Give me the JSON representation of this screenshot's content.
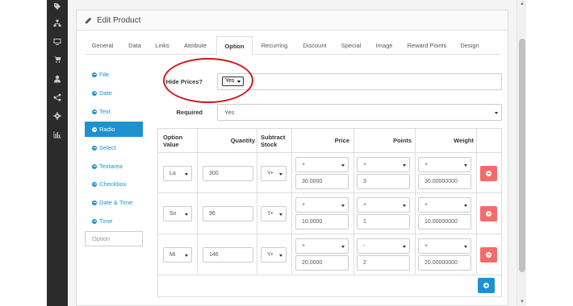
{
  "sidebar": {
    "icons": [
      "tags-icon",
      "sitemap-icon",
      "desktop-icon",
      "cart-icon",
      "user-icon",
      "share-icon",
      "cog-icon",
      "bar-chart-icon"
    ]
  },
  "panel": {
    "title": "Edit Product"
  },
  "tabs": [
    "General",
    "Data",
    "Links",
    "Attribute",
    "Option",
    "Recurring",
    "Discount",
    "Special",
    "Image",
    "Reward Points",
    "Design"
  ],
  "active_tab": "Option",
  "option_list": [
    "File",
    "Date",
    "Text",
    "Radio",
    "Select",
    "Textarea",
    "Checkbox",
    "Date & Time",
    "Time"
  ],
  "active_option": "Radio",
  "option_input_placeholder": "Option",
  "hide_prices": {
    "label": "Hide Prices?",
    "value": "Yes"
  },
  "required": {
    "label": "Required",
    "value": "Yes"
  },
  "table": {
    "headers": {
      "option_value": "Option Value",
      "quantity": "Quantity",
      "subtract_stock": "Subtract Stock",
      "price": "Price",
      "points": "Points",
      "weight": "Weight"
    },
    "rows": [
      {
        "option_value": "La",
        "quantity": "300",
        "subtract": "Y•",
        "price_prefix": "+",
        "price": "30.0000",
        "points_prefix": "+",
        "points": "3",
        "weight_prefix": "+",
        "weight": "30.00000000"
      },
      {
        "option_value": "Sn",
        "quantity": "96",
        "subtract": "Y•",
        "price_prefix": "+",
        "price": "10.0000",
        "points_prefix": "+",
        "points": "1",
        "weight_prefix": "+",
        "weight": "10.00000000"
      },
      {
        "option_value": "Mi",
        "quantity": "146",
        "subtract": "Y•",
        "price_prefix": "+",
        "price": "20.0000",
        "points_prefix": "-",
        "points": "2",
        "weight_prefix": "+",
        "weight": "20.00000000"
      }
    ]
  },
  "colors": {
    "accent": "#1e91cf",
    "danger": "#f56b6b",
    "highlight": "#d3171b",
    "sidebar": "#2b2b2b"
  }
}
